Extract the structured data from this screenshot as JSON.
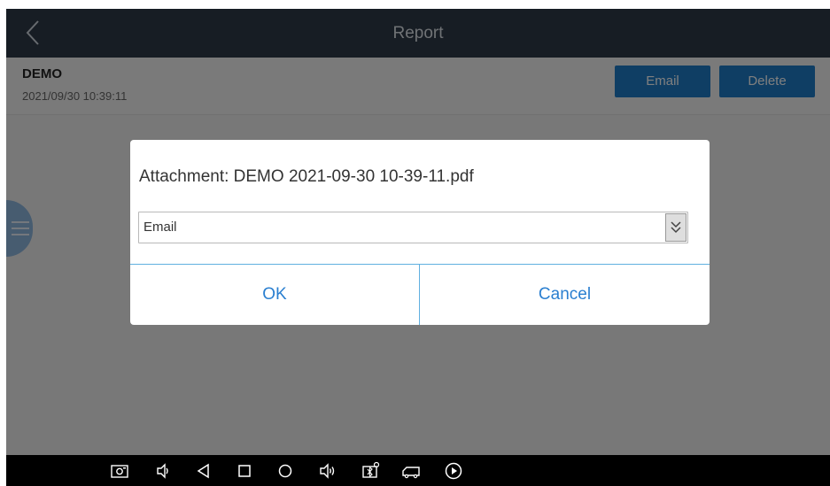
{
  "header": {
    "title": "Report",
    "back_icon": "chevron-left-icon"
  },
  "report": {
    "name": "DEMO",
    "date": "2021/09/30 10:39:11",
    "email_label": "Email",
    "delete_label": "Delete"
  },
  "dialog": {
    "attachment_text": "Attachment: DEMO 2021-09-30 10-39-11.pdf",
    "select_value": "Email",
    "ok_label": "OK",
    "cancel_label": "Cancel"
  },
  "navbar": {
    "icons": [
      "screenshot-icon",
      "volume-down-icon",
      "back-icon",
      "recents-icon",
      "home-icon",
      "volume-up-icon",
      "vci-icon",
      "vehicle-icon",
      "play-icon"
    ]
  },
  "colors": {
    "header_bg": "#2f3a48",
    "accent_button": "#1f7cc9",
    "dialog_button_text": "#2a7fd0",
    "divider": "#60b0e0"
  }
}
